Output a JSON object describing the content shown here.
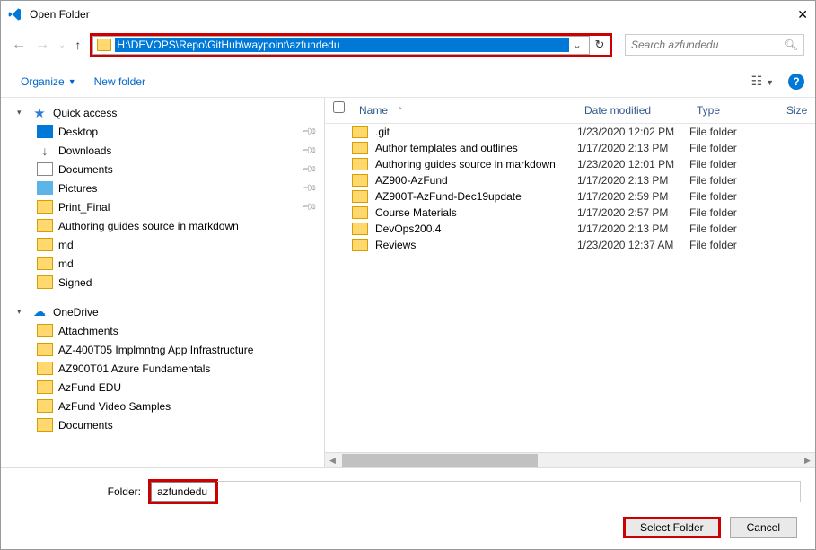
{
  "title": "Open Folder",
  "address_path": "H:\\DEVOPS\\Repo\\GitHub\\waypoint\\azfundedu",
  "search_placeholder": "Search azfundedu",
  "toolbar": {
    "organize": "Organize",
    "new_folder": "New folder"
  },
  "columns": {
    "name": "Name",
    "date": "Date modified",
    "type": "Type",
    "size": "Size"
  },
  "sidebar": {
    "quick_access": "Quick access",
    "quick_items": [
      {
        "label": "Desktop",
        "icon": "desktop-ic",
        "pinned": true
      },
      {
        "label": "Downloads",
        "icon": "down-ic",
        "pinned": true
      },
      {
        "label": "Documents",
        "icon": "doc-ic",
        "pinned": true
      },
      {
        "label": "Pictures",
        "icon": "pic-ic",
        "pinned": true
      },
      {
        "label": "Print_Final",
        "icon": "folder-ic",
        "pinned": true
      },
      {
        "label": "Authoring guides source in markdown",
        "icon": "folder-ic",
        "pinned": false
      },
      {
        "label": "md",
        "icon": "folder-ic",
        "pinned": false
      },
      {
        "label": "md",
        "icon": "folder-ic",
        "pinned": false
      },
      {
        "label": "Signed",
        "icon": "folder-ic",
        "pinned": false
      }
    ],
    "onedrive": "OneDrive",
    "onedrive_items": [
      {
        "label": "Attachments"
      },
      {
        "label": "AZ-400T05 Implmntng App Infrastructure"
      },
      {
        "label": "AZ900T01 Azure Fundamentals"
      },
      {
        "label": "AzFund EDU"
      },
      {
        "label": "AzFund Video Samples"
      },
      {
        "label": "Documents"
      }
    ]
  },
  "files": [
    {
      "name": ".git",
      "date": "1/23/2020 12:02 PM",
      "type": "File folder"
    },
    {
      "name": "Author templates and outlines",
      "date": "1/17/2020 2:13 PM",
      "type": "File folder"
    },
    {
      "name": "Authoring guides source in markdown",
      "date": "1/23/2020 12:01 PM",
      "type": "File folder"
    },
    {
      "name": "AZ900-AzFund",
      "date": "1/17/2020 2:13 PM",
      "type": "File folder"
    },
    {
      "name": "AZ900T-AzFund-Dec19update",
      "date": "1/17/2020 2:59 PM",
      "type": "File folder"
    },
    {
      "name": "Course Materials",
      "date": "1/17/2020 2:57 PM",
      "type": "File folder"
    },
    {
      "name": "DevOps200.4",
      "date": "1/17/2020 2:13 PM",
      "type": "File folder"
    },
    {
      "name": "Reviews",
      "date": "1/23/2020 12:37 AM",
      "type": "File folder"
    }
  ],
  "folder_label": "Folder:",
  "folder_value": "azfundedu",
  "buttons": {
    "select": "Select Folder",
    "cancel": "Cancel"
  }
}
